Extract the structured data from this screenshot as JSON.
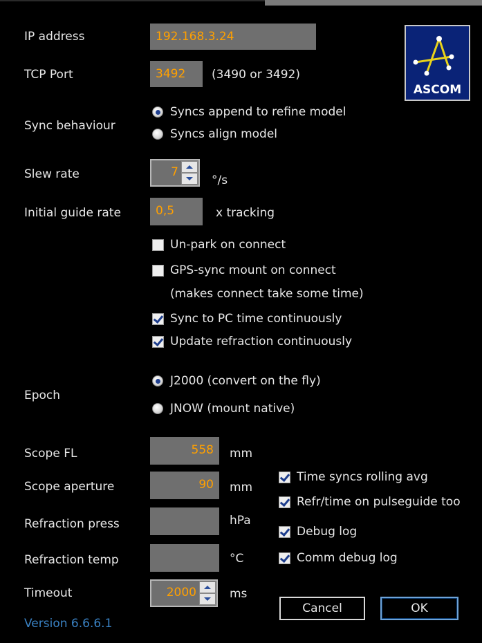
{
  "labels": {
    "ip_address": "IP address",
    "tcp_port": "TCP Port",
    "sync_behaviour": "Sync behaviour",
    "slew_rate": "Slew rate",
    "initial_guide_rate": "Initial guide rate",
    "epoch": "Epoch",
    "scope_fl": "Scope FL",
    "scope_aperture": "Scope aperture",
    "refraction_press": "Refraction press",
    "refraction_temp": "Refraction temp",
    "timeout": "Timeout"
  },
  "fields": {
    "ip_address": "192.168.3.24",
    "tcp_port": "3492",
    "slew_rate": "7",
    "initial_guide_rate": "0,5",
    "scope_fl": "558",
    "scope_aperture": "90",
    "refraction_press": "",
    "refraction_temp": "",
    "timeout": "2000"
  },
  "units": {
    "tcp_port_hint": "(3490  or 3492)",
    "slew_rate": "°/s",
    "guide_rate": "x tracking",
    "scope_fl": "mm",
    "scope_aperture": "mm",
    "refraction_press": "hPa",
    "refraction_temp": "°C",
    "timeout": "ms"
  },
  "sync_options": [
    {
      "label": "Syncs append to refine model",
      "selected": true
    },
    {
      "label": "Syncs align model",
      "selected": false
    }
  ],
  "epoch_options": [
    {
      "label": "J2000 (convert on the fly)",
      "selected": true
    },
    {
      "label": "JNOW (mount native)",
      "selected": false
    }
  ],
  "checkboxes": {
    "unpark": {
      "label": "Un-park on connect",
      "checked": false
    },
    "gps_sync": {
      "label": "GPS-sync mount on connect",
      "checked": false
    },
    "gps_note": "(makes connect take some time)",
    "sync_pc_time": {
      "label": "Sync to PC time continuously",
      "checked": true
    },
    "update_refraction": {
      "label": "Update refraction continuously",
      "checked": true
    },
    "time_syncs_avg": {
      "label": "Time syncs rolling avg",
      "checked": true
    },
    "refr_pulseguide": {
      "label": "Refr/time on pulseguide too",
      "checked": true
    },
    "debug_log": {
      "label": "Debug log",
      "checked": true
    },
    "comm_debug_log": {
      "label": "Comm debug log",
      "checked": true
    }
  },
  "buttons": {
    "cancel": "Cancel",
    "ok": "OK"
  },
  "logo": {
    "text": "ASCOM",
    "icon": "ascom-star-icon",
    "background": "#0a2377"
  },
  "version": "Version 6.6.6.1",
  "colors": {
    "value_text": "#ffa000",
    "field_bg": "#6f6f6f",
    "version_link": "#3a82c4"
  }
}
